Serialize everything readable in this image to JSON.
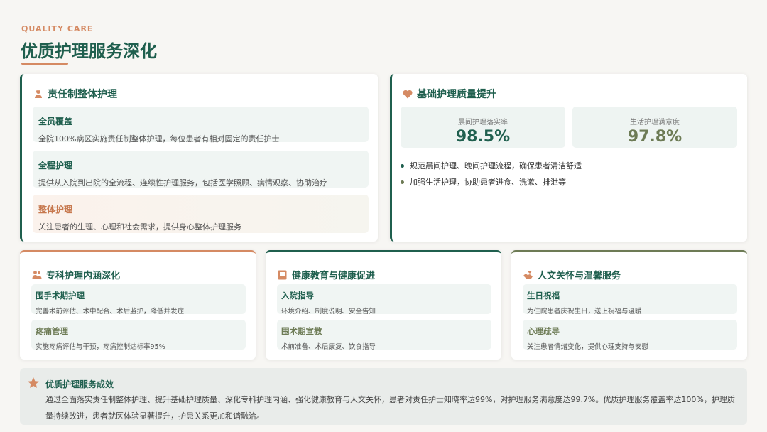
{
  "header": {
    "eyebrow": "QUALITY CARE",
    "title": "优质护理服务深化"
  },
  "colors": {
    "primary": "#1f5f4e",
    "accent": "#d58a63",
    "olive": "#6d7b55",
    "item_bg": "#f0f5f3",
    "item_bg_warm": "#fbf2ec"
  },
  "responsibility": {
    "title": "责任制整体护理",
    "icon": "nurse-icon",
    "items": [
      {
        "title": "全员覆盖",
        "desc": "全院100%病区实施责任制整体护理，每位患者有相对固定的责任护士"
      },
      {
        "title": "全程护理",
        "desc": "提供从入院到出院的全流程、连续性护理服务，包括医学照顾、病情观察、协助治疗"
      },
      {
        "title": "整体护理",
        "desc": "关注患者的生理、心理和社会需求，提供身心整体护理服务"
      }
    ]
  },
  "basic_quality": {
    "title": "基础护理质量提升",
    "icon": "heart-icon",
    "stats": [
      {
        "label": "晨间护理落实率",
        "value": "98.5%"
      },
      {
        "label": "生活护理满意度",
        "value": "97.8%"
      }
    ],
    "bullets": [
      "规范晨间护理、晚间护理流程，确保患者清洁舒适",
      "加强生活护理，协助患者进食、洗漱、排泄等"
    ]
  },
  "specialty": {
    "title": "专科护理内涵深化",
    "icon": "people-icon",
    "items": [
      {
        "title": "围手术期护理",
        "desc": "完善术前评估、术中配合、术后监护，降低并发症"
      },
      {
        "title": "疼痛管理",
        "desc": "实施疼痛评估与干预，疼痛控制达标率95%"
      }
    ]
  },
  "education": {
    "title": "健康教育与健康促进",
    "icon": "book-icon",
    "items": [
      {
        "title": "入院指导",
        "desc": "环境介绍、制度说明、安全告知"
      },
      {
        "title": "围术期宣教",
        "desc": "术前准备、术后康复、饮食指导"
      }
    ]
  },
  "humanistic": {
    "title": "人文关怀与温馨服务",
    "icon": "hands-heart-icon",
    "items": [
      {
        "title": "生日祝福",
        "desc": "为住院患者庆祝生日，送上祝福与温暖"
      },
      {
        "title": "心理疏导",
        "desc": "关注患者情绪变化，提供心理支持与安慰"
      }
    ]
  },
  "footer": {
    "icon": "star-icon",
    "title": "优质护理服务成效",
    "body": "通过全面落实责任制整体护理、提升基础护理质量、深化专科护理内涵、强化健康教育与人文关怀，患者对责任护士知晓率达99%，对护理服务满意度达99.7%。优质护理服务覆盖率达100%，护理质量持续改进，患者就医体验显著提升，护患关系更加和谐融洽。"
  }
}
